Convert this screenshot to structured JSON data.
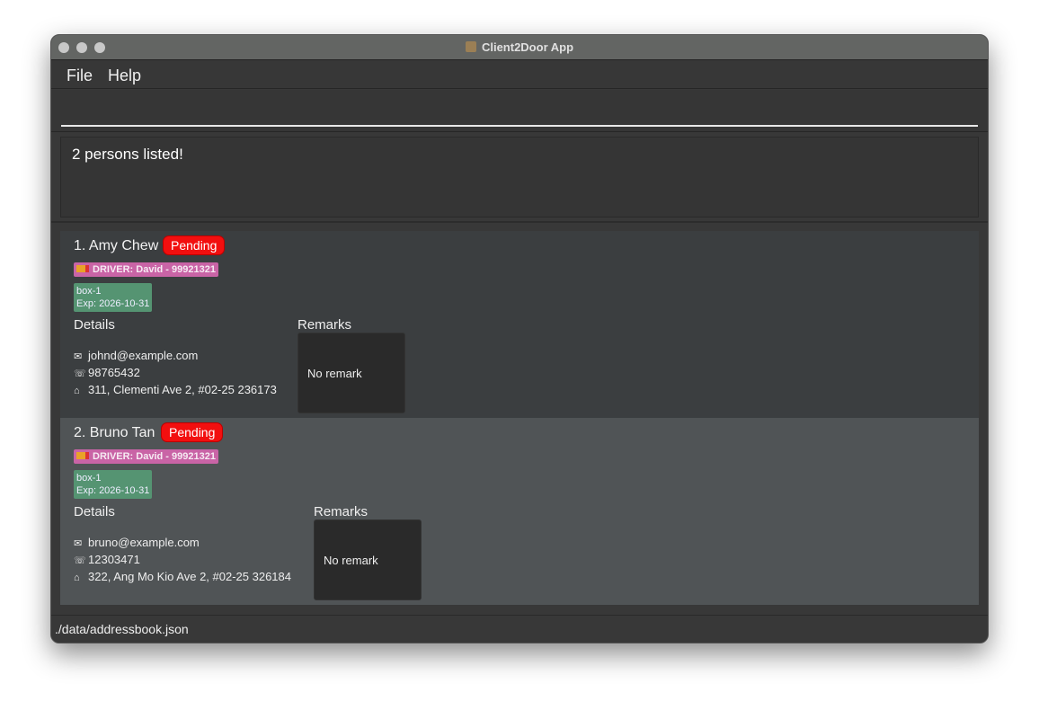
{
  "window": {
    "title": "Client2Door App"
  },
  "menu": {
    "file": "File",
    "help": "Help"
  },
  "command": {
    "value": ""
  },
  "result": {
    "text": "2 persons listed!"
  },
  "persons": [
    {
      "name": "1. Amy Chew",
      "status": "Pending",
      "driver": "DRIVER: David - 99921321",
      "box": "box-1",
      "expiry": "Exp: 2026-10-31",
      "details_label": "Details",
      "remarks_label": "Remarks",
      "email": "johnd@example.com",
      "phone": "98765432",
      "address": "311, Clementi Ave 2, #02-25 236173",
      "remark": "No remark"
    },
    {
      "name": "2. Bruno Tan",
      "status": "Pending",
      "driver": "DRIVER: David - 99921321",
      "box": "box-1",
      "expiry": "Exp: 2026-10-31",
      "details_label": "Details",
      "remarks_label": "Remarks",
      "email": "bruno@example.com",
      "phone": "12303471",
      "address": "322, Ang Mo Kio Ave 2, #02-25 326184",
      "remark": "No remark"
    }
  ],
  "status_bar": {
    "path": "./data/addressbook.json"
  }
}
